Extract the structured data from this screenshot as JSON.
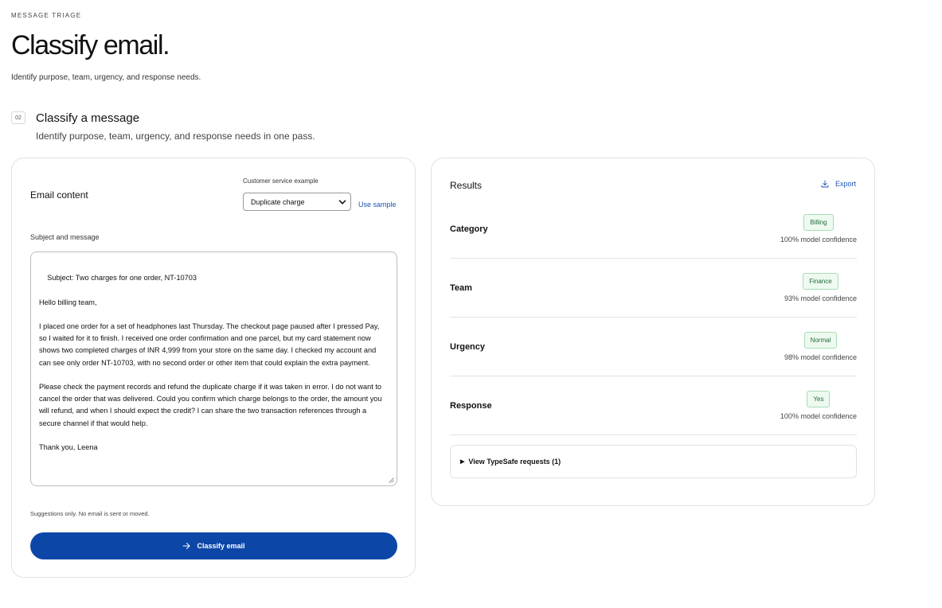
{
  "header": {
    "eyebrow": "MESSAGE TRIAGE",
    "title": "Classify email.",
    "subtitle": "Identify purpose, team, urgency, and response needs."
  },
  "section": {
    "step": "02",
    "title": "Classify a message",
    "subtitle": "Identify purpose, team, urgency, and response needs in one pass."
  },
  "form": {
    "heading": "Email content",
    "example_label": "Customer service example",
    "example_selected": "Duplicate charge",
    "use_sample": "Use sample",
    "field_label": "Subject and message",
    "message": "Subject: Two charges for one order, NT-10703\n\nHello billing team,\n\nI placed one order for a set of headphones last Thursday. The checkout page paused after I pressed Pay, so I waited for it to finish. I received one order confirmation and one parcel, but my card statement now shows two completed charges of INR 4,999 from your store on the same day. I checked my account and can see only order NT-10703, with no second order or other item that could explain the extra payment.\n\nPlease check the payment records and refund the duplicate charge if it was taken in error. I do not want to cancel the order that was delivered. Could you confirm which charge belongs to the order, the amount you will refund, and when I should expect the credit? I can share the two transaction references through a secure channel if that would help.\n\nThank you, Leena",
    "hint": "Suggestions only. No email is sent or moved.",
    "submit_label": "Classify email",
    "accent_color": "#0c47a8"
  },
  "results": {
    "title": "Results",
    "export_label": "Export",
    "rows": [
      {
        "label": "Category",
        "value": "Billing",
        "confidence": "100% model confidence"
      },
      {
        "label": "Team",
        "value": "Finance",
        "confidence": "93% model confidence"
      },
      {
        "label": "Urgency",
        "value": "Normal",
        "confidence": "98% model confidence"
      },
      {
        "label": "Response",
        "value": "Yes",
        "confidence": "100% model confidence"
      }
    ],
    "details_label": "View TypeSafe requests (1)",
    "badge_color": "#eefaf0"
  }
}
